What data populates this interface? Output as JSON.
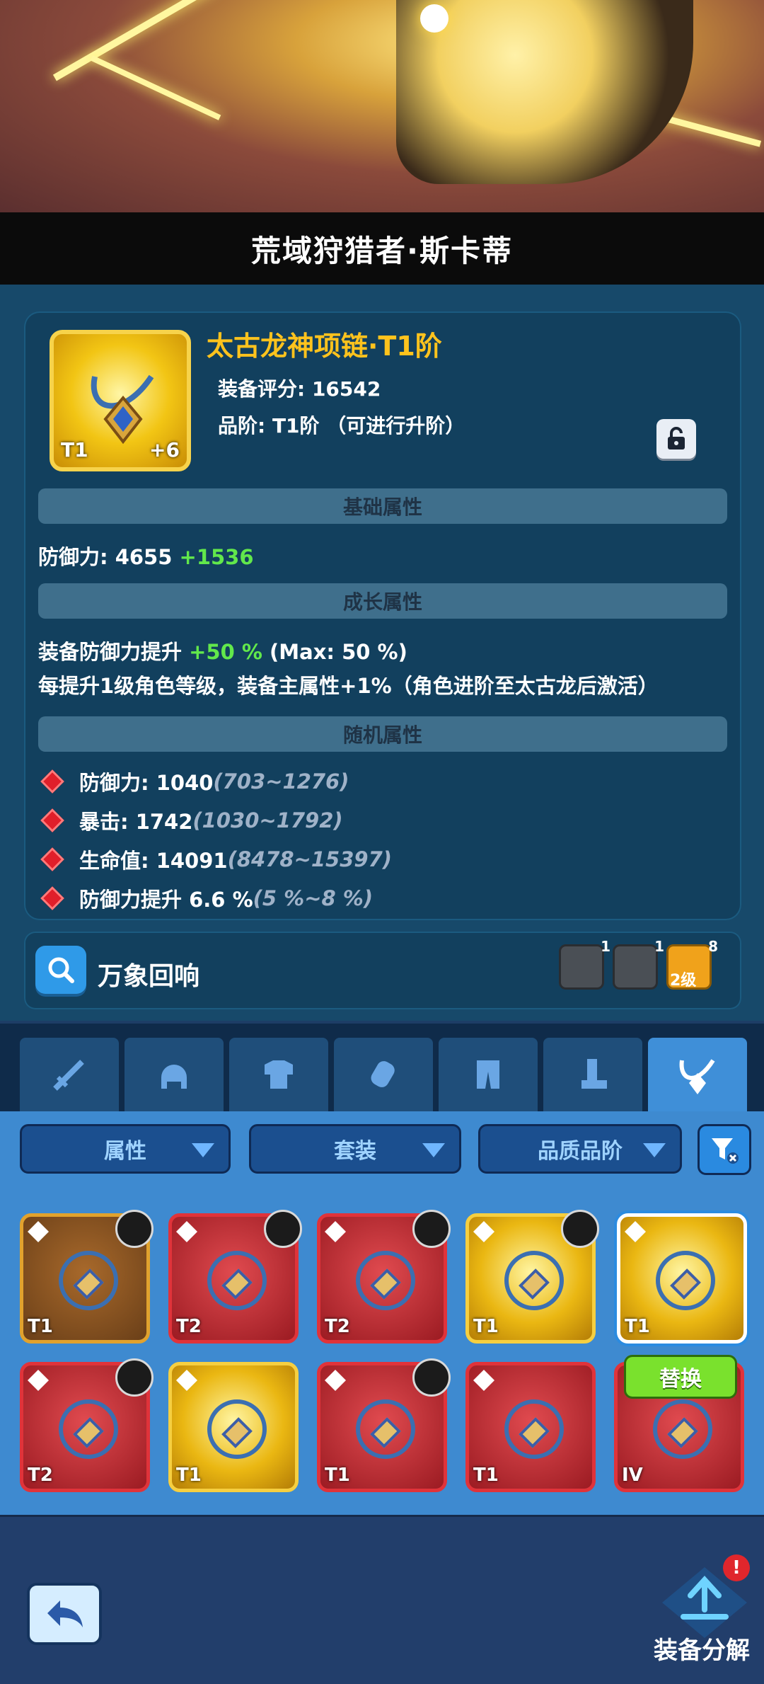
{
  "header": {
    "hero_name": "荒域狩猎者·斯卡蒂"
  },
  "item": {
    "name": "太古龙神项链·T1阶",
    "score_line": "装备评分: 16542",
    "tier_line": "品阶: T1阶 （可进行升阶）",
    "tier_badge": "T1",
    "level_badge": "+6"
  },
  "sections": {
    "base": "基础属性",
    "growth": "成长属性",
    "random": "随机属性"
  },
  "base_attr": {
    "label": "防御力: 4655 ",
    "bonus": "+1536"
  },
  "growth_attr": {
    "line1_prefix": "装备防御力提升 ",
    "line1_value": "+50 %",
    "line1_suffix": " (Max: 50 %)",
    "line2": "每提升1级角色等级，装备主属性+1%（角色进阶至太古龙后激活）"
  },
  "random_attrs": [
    {
      "label": "防御力: 1040 ",
      "range": "(703~1276)"
    },
    {
      "label": "暴击: 1742 ",
      "range": "(1030~1792)"
    },
    {
      "label": "生命值: 14091 ",
      "range": "(8478~15397)"
    },
    {
      "label": "防御力提升 6.6 % ",
      "range": "(5 %~8 %)"
    }
  ],
  "echo": {
    "label": "万象回响",
    "skills": [
      {
        "icon": "skull-icon",
        "count": "1"
      },
      {
        "icon": "snowflake-icon",
        "count": "1"
      },
      {
        "icon": "lightning-icon",
        "count": "8",
        "level": "2级"
      }
    ]
  },
  "tabs": [
    "weapon-icon",
    "helmet-icon",
    "armor-icon",
    "gauntlet-icon",
    "pants-icon",
    "boots-icon",
    "necklace-icon"
  ],
  "filters": {
    "attr": "属性",
    "set": "套装",
    "quality": "品质品阶"
  },
  "grid": [
    {
      "tier": "T1",
      "style": "brown"
    },
    {
      "tier": "T2",
      "style": "red"
    },
    {
      "tier": "T2",
      "style": "red"
    },
    {
      "tier": "T1",
      "style": "gold"
    },
    {
      "tier": "T1",
      "style": "gold"
    },
    {
      "tier": "T2",
      "style": "red"
    },
    {
      "tier": "T1",
      "style": "gold"
    },
    {
      "tier": "T1",
      "style": "red"
    },
    {
      "tier": "T1",
      "style": "red"
    },
    {
      "tier": "IV",
      "style": "red"
    }
  ],
  "replace_label": "替换",
  "bottom": {
    "decompose_label": "装备分解",
    "alert": "!"
  },
  "colors": {
    "gold": "#ffc31d",
    "green": "#62e84b",
    "accent_blue": "#3f8fd8"
  }
}
